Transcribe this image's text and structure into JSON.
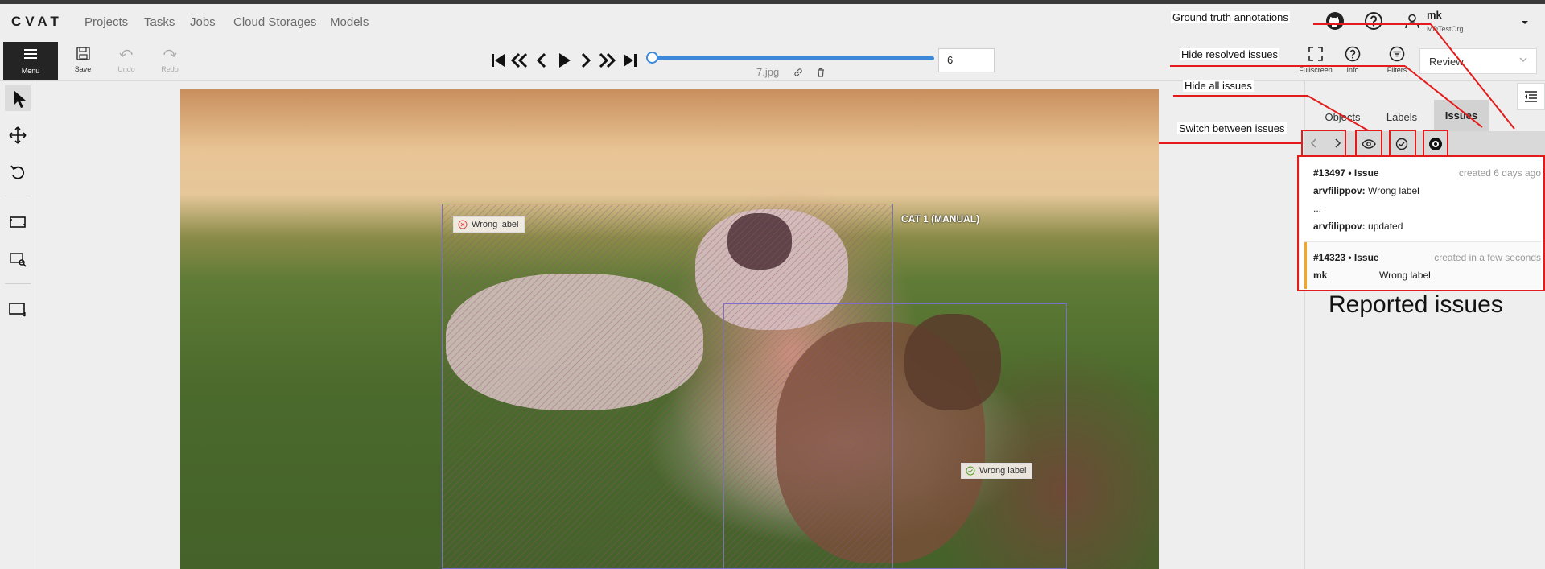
{
  "header": {
    "logo": "CVAT",
    "nav": [
      "Projects",
      "Tasks",
      "Jobs",
      "Cloud Storages",
      "Models"
    ],
    "user_name": "mk",
    "org": "MDTestOrg"
  },
  "toolbar": {
    "menu_label": "Menu",
    "save_label": "Save",
    "undo_label": "Undo",
    "redo_label": "Redo",
    "frame_number": "6",
    "frame_filename": "7.jpg",
    "slider_progress": 0.03,
    "fullscreen_label": "Fullscreen",
    "info_label": "Info",
    "filters_label": "Filters",
    "mode_value": "Review"
  },
  "canvas": {
    "issue_chip_1": "Wrong label",
    "issue_chip_2": "Wrong label",
    "object_label": "CAT 1 (MANUAL)"
  },
  "side_panel": {
    "tabs": [
      "Objects",
      "Labels",
      "Issues"
    ],
    "issues": [
      {
        "id": "#13497 • Issue",
        "created": "created 6 days ago",
        "lines": [
          {
            "author": "arvfilippov:",
            "text": " Wrong label"
          },
          {
            "author": "",
            "text": "..."
          },
          {
            "author": "arvfilippov:",
            "text": " updated"
          }
        ]
      },
      {
        "id": "#14323 • Issue",
        "created": "created in a few seconds",
        "lines": [
          {
            "author": "mk",
            "text": "Wrong label"
          }
        ]
      }
    ]
  },
  "annotations": {
    "ground_truth": "Ground truth annotations",
    "hide_resolved": "Hide resolved issues",
    "hide_all": "Hide all issues",
    "switch": "Switch between issues",
    "reported": "Reported issues"
  },
  "colors": {
    "accent": "#3d88db",
    "annotation_red": "#e41b1b",
    "issue_highlight": "#f5a623"
  }
}
